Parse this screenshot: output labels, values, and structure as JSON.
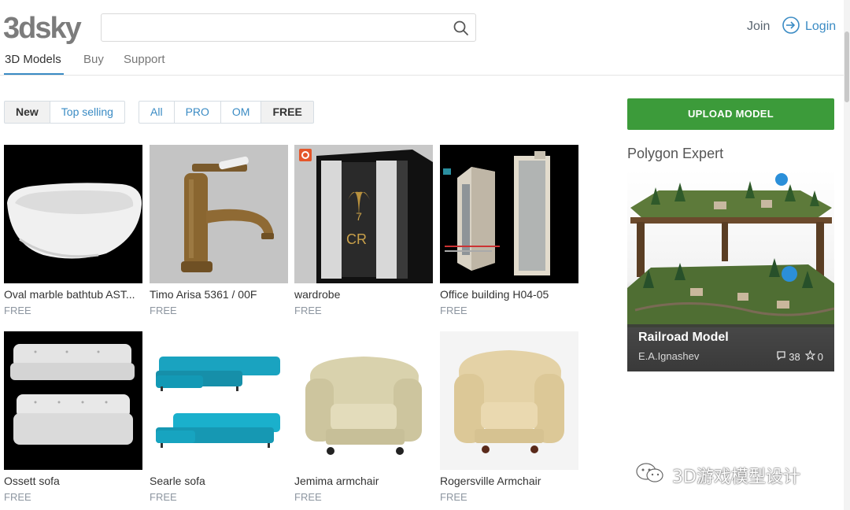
{
  "header": {
    "logo_text": "3dsky",
    "search": {
      "value": "",
      "placeholder": "",
      "icon": "search-icon"
    },
    "join_label": "Join",
    "login_label": "Login",
    "login_icon": "login-arrow-icon"
  },
  "nav": {
    "tabs": [
      {
        "label": "3D Models",
        "active": true
      },
      {
        "label": "Buy",
        "active": false
      },
      {
        "label": "Support",
        "active": false
      }
    ]
  },
  "sort_filter": [
    {
      "label": "New",
      "active": true
    },
    {
      "label": "Top selling",
      "active": false
    }
  ],
  "type_filter": [
    {
      "label": "All",
      "active": false
    },
    {
      "label": "PRO",
      "active": false
    },
    {
      "label": "OM",
      "active": false
    },
    {
      "label": "FREE",
      "active": true
    }
  ],
  "models": [
    {
      "name": "Oval marble bathtub AST...",
      "price": "FREE"
    },
    {
      "name": "Timo Arisa 5361 / 00F",
      "price": "FREE"
    },
    {
      "name": "wardrobe",
      "price": "FREE",
      "badge_icon": "corona-render-icon"
    },
    {
      "name": "Office building H04-05",
      "price": "FREE"
    },
    {
      "name": "Ossett sofa",
      "price": "FREE"
    },
    {
      "name": "Searle sofa",
      "price": "FREE"
    },
    {
      "name": "Jemima armchair",
      "price": "FREE"
    },
    {
      "name": "Rogersville Armchair",
      "price": "FREE"
    }
  ],
  "sidebar": {
    "upload_label": "UPLOAD MODEL",
    "promo_title": "Polygon Expert",
    "promo": {
      "name": "Railroad Model",
      "author": "E.A.Ignashev",
      "comments": "38",
      "stars": "0"
    }
  },
  "watermark": {
    "text": "3D游戏模型设计",
    "icon": "wechat-icon"
  },
  "colors": {
    "accent": "#3a8bc4",
    "upload_green": "#3c9b3a",
    "muted": "#8d96a0"
  }
}
